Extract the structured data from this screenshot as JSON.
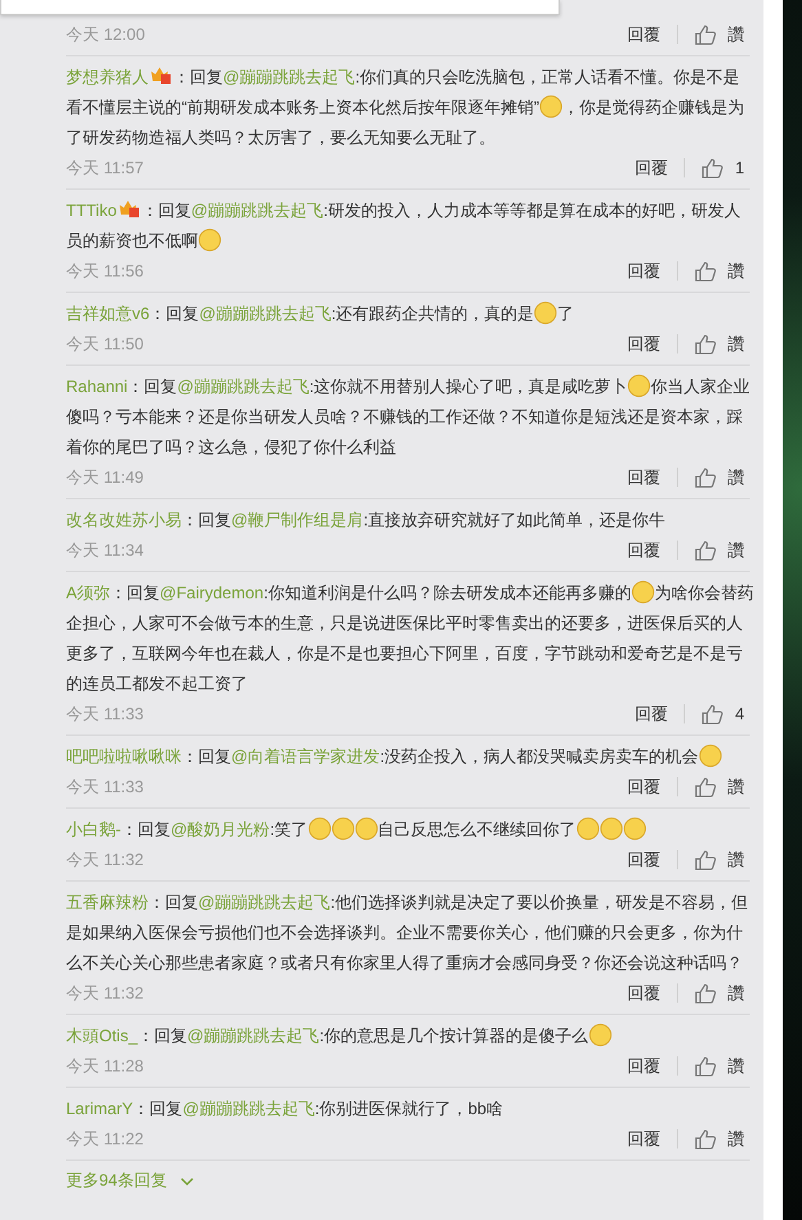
{
  "first_footer": {
    "time": "今天 12:00",
    "reply": "回覆",
    "likes": "讚"
  },
  "comments": [
    {
      "user": "梦想养猪人",
      "badge": true,
      "prefix": "：回复",
      "mention": "@蹦蹦跳跳去起飞",
      "body": [
        {
          "kind": "text",
          "text": ":你们真的只会吃洗脑包，正常人话看不懂。你是不是看不懂层主说的“前期研发成本账务上资本化然后按年限逐年摊销”"
        },
        {
          "kind": "emoji"
        },
        {
          "kind": "text",
          "text": "，你是觉得药企赚钱是为了研发药物造福人类吗？太厉害了，要么无知要么无耻了。"
        }
      ],
      "time": "今天 11:57",
      "reply": "回覆",
      "likes": "1"
    },
    {
      "user": "TTTiko",
      "badge": true,
      "prefix": "：回复",
      "mention": "@蹦蹦跳跳去起飞",
      "body": [
        {
          "kind": "text",
          "text": ":研发的投入，人力成本等等都是算在成本的好吧，研发人员的薪资也不低啊"
        },
        {
          "kind": "emoji"
        }
      ],
      "time": "今天 11:56",
      "reply": "回覆",
      "likes": "讚"
    },
    {
      "user": "吉祥如意v6",
      "badge": false,
      "prefix": "：回复",
      "mention": "@蹦蹦跳跳去起飞",
      "body": [
        {
          "kind": "text",
          "text": ":还有跟药企共情的，真的是"
        },
        {
          "kind": "emoji"
        },
        {
          "kind": "text",
          "text": "了"
        }
      ],
      "time": "今天 11:50",
      "reply": "回覆",
      "likes": "讚"
    },
    {
      "user": "Rahanni",
      "badge": false,
      "prefix": "：回复",
      "mention": "@蹦蹦跳跳去起飞",
      "body": [
        {
          "kind": "text",
          "text": ":这你就不用替别人操心了吧，真是咸吃萝卜"
        },
        {
          "kind": "emoji"
        },
        {
          "kind": "text",
          "text": "你当人家企业傻吗？亏本能来？还是你当研发人员啥？不赚钱的工作还做？不知道你是短浅还是资本家，踩着你的尾巴了吗？这么急，侵犯了你什么利益"
        }
      ],
      "time": "今天 11:49",
      "reply": "回覆",
      "likes": "讚"
    },
    {
      "user": "改名改姓苏小易",
      "badge": false,
      "prefix": "：回复",
      "mention": "@鞭尸制作组是肩",
      "body": [
        {
          "kind": "text",
          "text": ":直接放弃研究就好了如此简单，还是你牛"
        }
      ],
      "time": "今天 11:34",
      "reply": "回覆",
      "likes": "讚"
    },
    {
      "user": "A须弥",
      "badge": false,
      "prefix": "：回复",
      "mention": "@Fairydemon",
      "body": [
        {
          "kind": "text",
          "text": ":你知道利润是什么吗？除去研发成本还能再多赚的"
        },
        {
          "kind": "emoji"
        },
        {
          "kind": "text",
          "text": "为啥你会替药企担心，人家可不会做亏本的生意，只是说进医保比平时零售卖出的还要多，进医保后买的人更多了，互联网今年也在裁人，你是不是也要担心下阿里，百度，字节跳动和爱奇艺是不是亏的连员工都发不起工资了"
        }
      ],
      "time": "今天 11:33",
      "reply": "回覆",
      "likes": "4"
    },
    {
      "user": "吧吧啦啦啾啾咪",
      "badge": false,
      "prefix": "：回复",
      "mention": "@向着语言学家进发",
      "body": [
        {
          "kind": "text",
          "text": ":没药企投入，病人都没哭喊卖房卖车的机会"
        },
        {
          "kind": "emoji"
        }
      ],
      "time": "今天 11:33",
      "reply": "回覆",
      "likes": "讚"
    },
    {
      "user": "小白鹅-",
      "badge": false,
      "prefix": "：回复",
      "mention": "@酸奶月光粉",
      "body": [
        {
          "kind": "text",
          "text": ":笑了"
        },
        {
          "kind": "emoji"
        },
        {
          "kind": "emoji"
        },
        {
          "kind": "emoji"
        },
        {
          "kind": "text",
          "text": "自己反思怎么不继续回你了"
        },
        {
          "kind": "emoji"
        },
        {
          "kind": "emoji"
        },
        {
          "kind": "emoji"
        }
      ],
      "time": "今天 11:32",
      "reply": "回覆",
      "likes": "讚"
    },
    {
      "user": "五香麻辣粉",
      "badge": false,
      "prefix": "：回复",
      "mention": "@蹦蹦跳跳去起飞",
      "body": [
        {
          "kind": "text",
          "text": ":他们选择谈判就是决定了要以价换量，研发是不容易，但是如果纳入医保会亏损他们也不会选择谈判。企业不需要你关心，他们赚的只会更多，你为什么不关心关心那些患者家庭？或者只有你家里人得了重病才会感同身受？你还会说这种话吗？"
        }
      ],
      "time": "今天 11:32",
      "reply": "回覆",
      "likes": "讚"
    },
    {
      "user": "木頭Otis_",
      "badge": false,
      "prefix": "：回复",
      "mention": "@蹦蹦跳跳去起飞",
      "body": [
        {
          "kind": "text",
          "text": ":你的意思是几个按计算器的是傻子么"
        },
        {
          "kind": "emoji"
        }
      ],
      "time": "今天 11:28",
      "reply": "回覆",
      "likes": "讚"
    },
    {
      "user": "LarimarY",
      "badge": false,
      "prefix": "：回复",
      "mention": "@蹦蹦跳跳去起飞",
      "body": [
        {
          "kind": "text",
          "text": ":你别进医保就行了，bb啥"
        }
      ],
      "time": "今天 11:22",
      "reply": "回覆",
      "likes": "讚"
    }
  ],
  "more_replies": "更多94条回复"
}
